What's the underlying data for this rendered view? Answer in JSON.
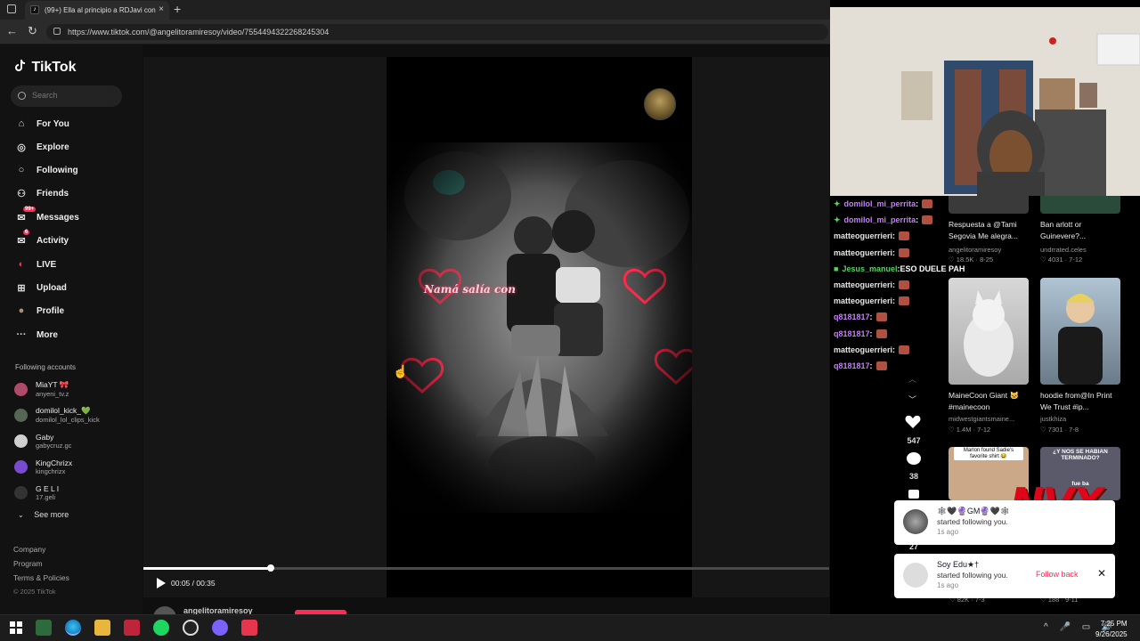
{
  "browser": {
    "tab_title": "(99+) Ella al principio a RDJavi con",
    "tab_close": "×",
    "new_tab": "+",
    "url": "https://www.tiktok.com/@angelitoramiresoy/video/7554494322268245304",
    "back": "←",
    "reload": "↻"
  },
  "tiktok": {
    "logo": "TikTok",
    "search_placeholder": "Search",
    "nav": [
      {
        "label": "For You",
        "icon": "home-icon"
      },
      {
        "label": "Explore",
        "icon": "compass-icon"
      },
      {
        "label": "Following",
        "icon": "following-icon"
      },
      {
        "label": "Friends",
        "icon": "friends-icon"
      },
      {
        "label": "Messages",
        "icon": "message-icon",
        "badge": "99+"
      },
      {
        "label": "Activity",
        "icon": "activity-icon",
        "badge": "6"
      },
      {
        "label": "LIVE",
        "icon": "live-icon"
      },
      {
        "label": "Upload",
        "icon": "upload-icon"
      },
      {
        "label": "Profile",
        "icon": "profile-icon"
      },
      {
        "label": "More",
        "icon": "more-icon"
      }
    ],
    "following_header": "Following accounts",
    "following": [
      {
        "name": "MiaYT 🎀",
        "handle": "anyeni_tv.z",
        "color": "#b04a6a"
      },
      {
        "name": "domilol_kick_💚",
        "handle": "domilol_lol_clips_kick",
        "color": "#556655"
      },
      {
        "name": "Gaby",
        "handle": "gabycruz.gc",
        "color": "#cfcfcf"
      },
      {
        "name": "KingChrizx",
        "handle": "kingchrizx",
        "color": "#7a4ad0"
      },
      {
        "name": "G E L I",
        "handle": "17.geli",
        "color": "#333333"
      }
    ],
    "see_more": "See more",
    "footer": [
      "Company",
      "Program",
      "Terms & Policies",
      "© 2025 TikTok"
    ]
  },
  "video": {
    "overlay_caption": "Namá salía con",
    "time": "00:05 / 00:35",
    "progress": 0.186,
    "author": "angelitoramiresoy"
  },
  "stream_chat": [
    {
      "user": "domilol_mi_perrita",
      "sep": " :",
      "msg": "",
      "color": "#c77dff",
      "gem": "✦"
    },
    {
      "user": "domilol_mi_perrita",
      "sep": " :",
      "msg": "",
      "color": "#c77dff",
      "gem": "✦"
    },
    {
      "user": "matteoguerrieri",
      "sep": " :",
      "msg": "",
      "color": "#e6e6e6",
      "gem": ""
    },
    {
      "user": "matteoguerrieri",
      "sep": " :",
      "msg": "",
      "color": "#e6e6e6",
      "gem": ""
    },
    {
      "user": "Jesus_manuel",
      "sep": " :",
      "msg": " ESO DUELE PAH",
      "color": "#56d364",
      "gem": "■"
    },
    {
      "user": "matteoguerrieri",
      "sep": " :",
      "msg": "",
      "color": "#e6e6e6",
      "gem": ""
    },
    {
      "user": "matteoguerrieri",
      "sep": " :",
      "msg": "",
      "color": "#e6e6e6",
      "gem": ""
    },
    {
      "user": "q8181817",
      "sep": " :",
      "msg": "",
      "color": "#c77dff",
      "gem": ""
    },
    {
      "user": "q8181817",
      "sep": " :",
      "msg": "",
      "color": "#c77dff",
      "gem": ""
    },
    {
      "user": "matteoguerrieri",
      "sep": " :",
      "msg": "",
      "color": "#e6e6e6",
      "gem": ""
    },
    {
      "user": "q8181817",
      "sep": " :",
      "msg": "",
      "color": "#c77dff",
      "gem": ""
    }
  ],
  "side_actions": {
    "likes": "547",
    "comments": "38",
    "shares": "27"
  },
  "recommended": [
    {
      "title": "Respuesta a @Tami Segovia Me alegra...",
      "author": "angelitoramiresoy",
      "likes": "♡ 18.5K",
      "date": "8-25"
    },
    {
      "title": "Ban arlott or Guinevere?...",
      "author": "undrrated.celes",
      "likes": "♡ 4031",
      "date": "7-12"
    },
    {
      "title": "MaineCoon Giant 🐱 #mainecoon",
      "author": "midwestgiantsmaine...",
      "likes": "♡ 1.4M",
      "date": "7-12"
    },
    {
      "title": "hoodie from@In Print We Trust #ip...",
      "author": "justkhiza",
      "likes": "♡ 7301",
      "date": "7-8"
    },
    {
      "title": "",
      "author": "",
      "likes": "♡ 82K",
      "date": "7-3"
    },
    {
      "title": "",
      "author": "",
      "likes": "♡ 188",
      "date": "9-11"
    }
  ],
  "thumb_captions": {
    "cat_note": "Marlon found Sadie's favorite shirt 😂",
    "quote_top": "¿Y NOS SE HABIAN TERMINADO?",
    "quote_bottom": "fue ba"
  },
  "toasts": [
    {
      "name": "🕸🖤🔮GM🔮🖤🕸",
      "msg": "started following you.",
      "ago": "1s ago",
      "action": ""
    },
    {
      "name": "Soy Edu★†",
      "msg": "started following you.",
      "ago": "1s ago",
      "action": "Follow back"
    }
  ],
  "watermark": "NVX",
  "taskbar": {
    "time": "7:25 PM",
    "date": "9/26/2025"
  },
  "colors": {
    "accent": "#fe2c55",
    "bg": "#0f0f0f"
  }
}
